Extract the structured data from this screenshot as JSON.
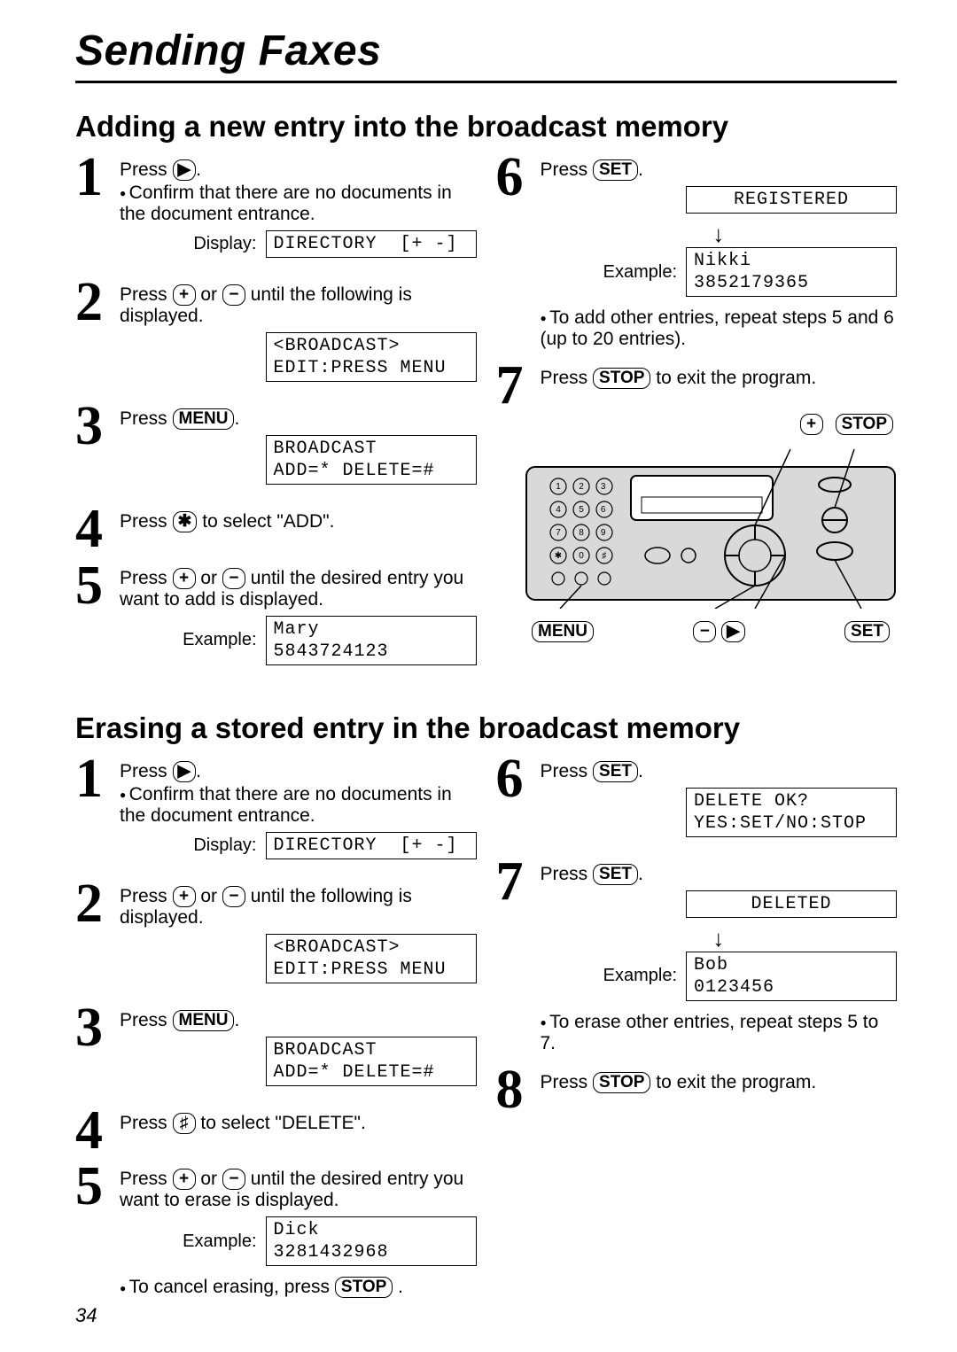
{
  "page_title": "Sending Faxes",
  "page_number": "34",
  "sections": {
    "add": {
      "title": "Adding a new entry into the broadcast memory",
      "left": {
        "s1": {
          "press": "Press ",
          "key": "▶",
          "confirm": "Confirm that there are no documents in the document entrance.",
          "display_lbl": "Display:",
          "lcd": "DIRECTORY  [+ -]"
        },
        "s2": {
          "text_a": "Press ",
          "key_a": "+",
          "text_b": " or ",
          "key_b": "−",
          "text_c": " until the following is displayed.",
          "lcd": "<BROADCAST>\nEDIT:PRESS MENU"
        },
        "s3": {
          "press": "Press ",
          "key": "MENU",
          "lcd": "BROADCAST\nADD=* DELETE=#"
        },
        "s4": {
          "text_a": "Press ",
          "key": "✱",
          "text_b": " to select \"ADD\"."
        },
        "s5": {
          "text_a": "Press ",
          "key_a": "+",
          "text_b": " or ",
          "key_b": "−",
          "text_c": " until the desired entry you want to add is displayed.",
          "example_lbl": "Example:",
          "lcd": "Mary\n5843724123"
        }
      },
      "right": {
        "s6": {
          "press": "Press ",
          "key": "SET",
          "lcd1": "REGISTERED",
          "example_lbl": "Example:",
          "lcd2": "Nikki\n3852179365",
          "note": "To add other entries, repeat steps 5 and 6 (up to 20 entries)."
        },
        "s7": {
          "text_a": "Press ",
          "key": "STOP",
          "text_b": " to exit the program."
        },
        "callouts": {
          "plus": "+",
          "stop": "STOP",
          "menu": "MENU",
          "minus": "−",
          "play": "▶",
          "set": "SET"
        }
      }
    },
    "erase": {
      "title": "Erasing a stored entry in the broadcast memory",
      "left": {
        "s1": {
          "press": "Press ",
          "key": "▶",
          "confirm": "Confirm that there are no documents in the document entrance.",
          "display_lbl": "Display:",
          "lcd": "DIRECTORY  [+ -]"
        },
        "s2": {
          "text_a": "Press ",
          "key_a": "+",
          "text_b": " or ",
          "key_b": "−",
          "text_c": " until the following is displayed.",
          "lcd": "<BROADCAST>\nEDIT:PRESS MENU"
        },
        "s3": {
          "press": "Press ",
          "key": "MENU",
          "lcd": "BROADCAST\nADD=* DELETE=#"
        },
        "s4": {
          "text_a": "Press ",
          "key": "♯",
          "text_b": " to select \"DELETE\"."
        },
        "s5": {
          "text_a": "Press ",
          "key_a": "+",
          "text_b": " or ",
          "key_b": "−",
          "text_c": " until the desired entry you want to erase is displayed.",
          "example_lbl": "Example:",
          "lcd": "Dick\n3281432968",
          "cancel_a": "To cancel erasing, press ",
          "cancel_key": "STOP",
          "cancel_b": "."
        }
      },
      "right": {
        "s6": {
          "press": "Press ",
          "key": "SET",
          "lcd": "DELETE OK?\nYES:SET/NO:STOP"
        },
        "s7": {
          "press": "Press ",
          "key": "SET",
          "lcd1": "DELETED",
          "example_lbl": "Example:",
          "lcd2": "Bob\n0123456",
          "note": "To erase other entries, repeat steps 5 to 7."
        },
        "s8": {
          "text_a": "Press ",
          "key": "STOP",
          "text_b": " to exit the program."
        }
      }
    }
  }
}
